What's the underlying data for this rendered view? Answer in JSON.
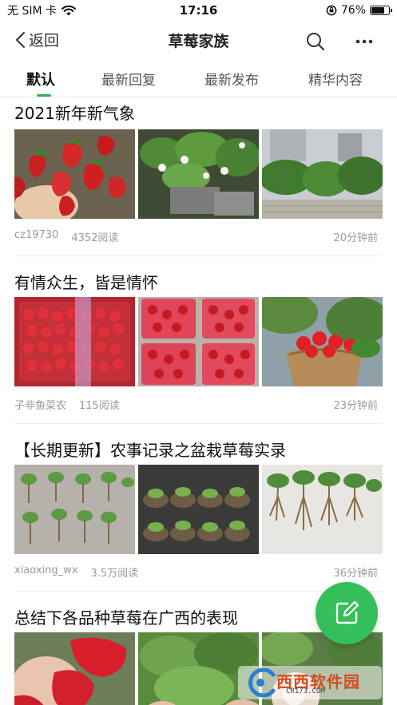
{
  "status_bar": {
    "carrier": "无 SIM 卡",
    "time": "17:16",
    "battery_percent": "76%",
    "battery_level": 0.76
  },
  "nav": {
    "back_label": "返回",
    "title": "草莓家族"
  },
  "tabs": [
    {
      "label": "默认",
      "active": true
    },
    {
      "label": "最新回复",
      "active": false
    },
    {
      "label": "最新发布",
      "active": false
    },
    {
      "label": "精华内容",
      "active": false
    }
  ],
  "posts": [
    {
      "title": "2021新年新气象",
      "author": "cz19730",
      "reads": "4352阅读",
      "time": "20分钟前",
      "images": [
        "strawberries-in-hand",
        "potted-strawberry-plants-flowers",
        "balcony-strawberry-planters"
      ]
    },
    {
      "title": "有情众生，皆是情怀",
      "author": "子非鱼菜农",
      "reads": "115阅读",
      "time": "23分钟前",
      "images": [
        "strawberries-in-red-crate",
        "strawberry-baskets",
        "strawberries-in-woven-basket"
      ]
    },
    {
      "title": "【长期更新】农事记录之盆栽草莓实录",
      "author": "xiaoxing_wx",
      "reads": "3.5万阅读",
      "time": "36分钟前",
      "images": [
        "strawberry-seedlings-on-ground",
        "seedlings-in-pots",
        "seedling-roots"
      ]
    },
    {
      "title": "总结下各品种草莓在广西的表现",
      "author": "",
      "reads": "",
      "time": "",
      "images": [
        "red-strawberries-in-hand",
        "strawberry-leaves",
        "white-strawberry"
      ]
    }
  ],
  "watermark": {
    "text": "西西软件园",
    "url": "CR173.COM"
  },
  "colors": {
    "accent": "#2bb24c",
    "fab": "#35bf5a",
    "meta_text": "#999999"
  },
  "icons": {
    "back": "chevron-left-icon",
    "search": "search-icon",
    "more": "more-dots-icon",
    "compose": "compose-icon",
    "wifi": "wifi-icon",
    "orientation_lock": "orientation-lock-icon"
  }
}
